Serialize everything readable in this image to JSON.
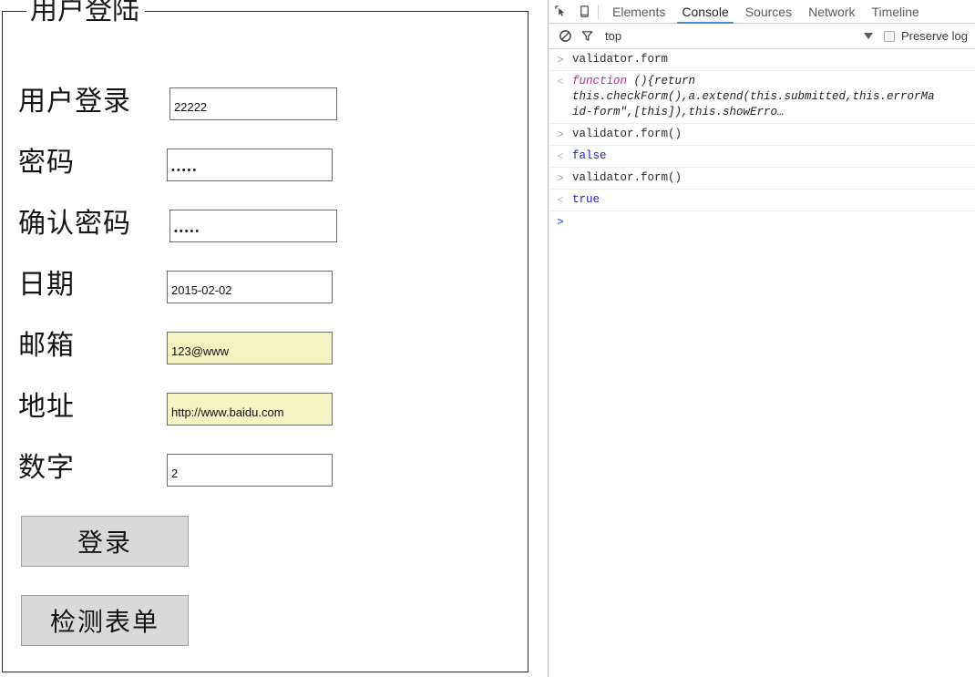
{
  "page": {
    "legend": "用户登陆",
    "form": {
      "rows": [
        {
          "label": "用户登录",
          "value": "22222",
          "type": "text",
          "invalid": false
        },
        {
          "label": "密码",
          "value": "•••••",
          "type": "password",
          "invalid": false
        },
        {
          "label": "确认密码",
          "value": "•••••",
          "type": "password",
          "invalid": false
        },
        {
          "label": "日期",
          "value": "2015-02-02",
          "type": "text",
          "invalid": false
        },
        {
          "label": "邮箱",
          "value": "123@www",
          "type": "text",
          "invalid": true
        },
        {
          "label": "地址",
          "value": "http://www.baidu.com",
          "type": "text",
          "invalid": true
        },
        {
          "label": "数字",
          "value": "2",
          "type": "text",
          "invalid": false
        }
      ]
    },
    "buttons": {
      "login": "登录",
      "check": "检测表单"
    },
    "colors": {
      "invalid_field_bg": "#f4f4c2",
      "button_bg": "#d9d9d9",
      "fieldset_border": "#2b2b2b"
    }
  },
  "devtools": {
    "tabs": [
      {
        "label": "Elements",
        "active": false
      },
      {
        "label": "Console",
        "active": true
      },
      {
        "label": "Sources",
        "active": false
      },
      {
        "label": "Network",
        "active": false
      },
      {
        "label": "Timeline",
        "active": false
      }
    ],
    "toolbar_icons": [
      "inspect-element-icon",
      "device-toolbar-icon"
    ],
    "filterbar": {
      "clear_icon": "clear-console-icon",
      "filter_icon": "filter-icon",
      "context": "top",
      "caret": "chevron-down-icon",
      "preserve_log_label": "Preserve log",
      "preserve_log_checked": false
    },
    "active_tab_underline_color": "#4a90d9",
    "console": {
      "prompt_in": ">",
      "prompt_out": "<",
      "rows": [
        {
          "kind": "input",
          "text": "validator.form"
        },
        {
          "kind": "output-function",
          "keyword": "function",
          "text": " (){return this.checkForm(),a.extend(this.submitted,this.errorMa",
          "line2": "id-form\",[this]),this.showErro…"
        },
        {
          "kind": "input",
          "text": "validator.form()"
        },
        {
          "kind": "output-bool",
          "text": "false"
        },
        {
          "kind": "input",
          "text": "validator.form()"
        },
        {
          "kind": "output-bool",
          "text": "true"
        },
        {
          "kind": "prompt",
          "text": ""
        }
      ]
    }
  }
}
